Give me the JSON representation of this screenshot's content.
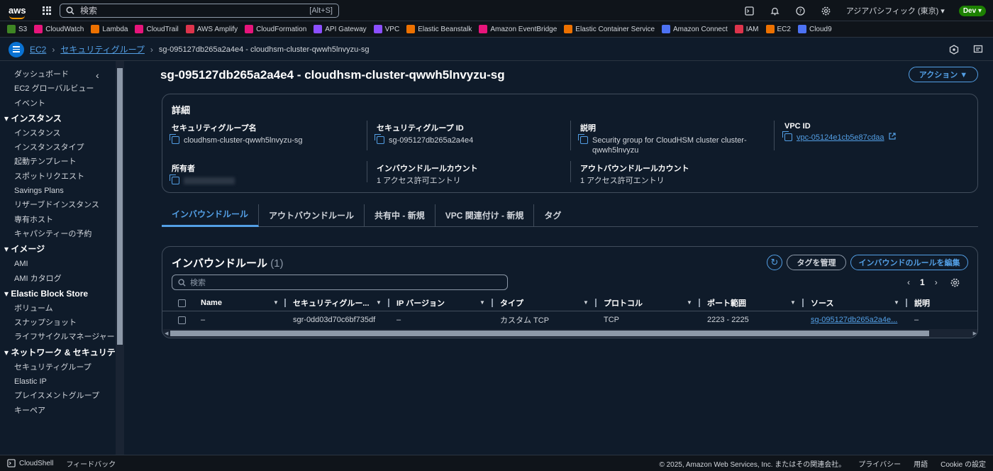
{
  "topbar": {
    "logo": "aws",
    "search_placeholder": "検索",
    "search_shortcut": "[Alt+S]",
    "region": "アジアパシフィック (東京)",
    "account_badge": "Dev"
  },
  "favorites": [
    {
      "label": "S3",
      "color": "#3f8624"
    },
    {
      "label": "CloudWatch",
      "color": "#e7157b"
    },
    {
      "label": "Lambda",
      "color": "#ed7100"
    },
    {
      "label": "CloudTrail",
      "color": "#e7157b"
    },
    {
      "label": "AWS Amplify",
      "color": "#dd344c"
    },
    {
      "label": "CloudFormation",
      "color": "#e7157b"
    },
    {
      "label": "API Gateway",
      "color": "#8c4fff"
    },
    {
      "label": "VPC",
      "color": "#8c4fff"
    },
    {
      "label": "Elastic Beanstalk",
      "color": "#ed7100"
    },
    {
      "label": "Amazon EventBridge",
      "color": "#e7157b"
    },
    {
      "label": "Elastic Container Service",
      "color": "#ed7100"
    },
    {
      "label": "Amazon Connect",
      "color": "#4d72f3"
    },
    {
      "label": "IAM",
      "color": "#dd344c"
    },
    {
      "label": "EC2",
      "color": "#ed7100"
    },
    {
      "label": "Cloud9",
      "color": "#4d72f3"
    }
  ],
  "breadcrumb": {
    "items": [
      "EC2",
      "セキュリティグループ"
    ],
    "current": "sg-095127db265a2a4e4 - cloudhsm-cluster-qwwh5lnvyzu-sg"
  },
  "sidebar": {
    "top": [
      "ダッシュボード",
      "EC2 グローバルビュー",
      "イベント"
    ],
    "sections": [
      {
        "title": "インスタンス",
        "items": [
          "インスタンス",
          "インスタンスタイプ",
          "起動テンプレート",
          "スポットリクエスト",
          "Savings Plans",
          "リザーブドインスタンス",
          "専有ホスト",
          "キャパシティーの予約"
        ]
      },
      {
        "title": "イメージ",
        "items": [
          "AMI",
          "AMI カタログ"
        ]
      },
      {
        "title": "Elastic Block Store",
        "items": [
          "ボリューム",
          "スナップショット",
          "ライフサイクルマネージャー"
        ]
      },
      {
        "title": "ネットワーク & セキュリティ",
        "items": [
          "セキュリティグループ",
          "Elastic IP",
          "プレイスメントグループ",
          "キーペア"
        ]
      }
    ]
  },
  "page": {
    "title": "sg-095127db265a2a4e4 - cloudhsm-cluster-qwwh5lnvyzu-sg",
    "actions_label": "アクション ▼"
  },
  "details": {
    "title": "詳細",
    "sg_name_label": "セキュリティグループ名",
    "sg_name": "cloudhsm-cluster-qwwh5lnvyzu-sg",
    "sg_id_label": "セキュリティグループ ID",
    "sg_id": "sg-095127db265a2a4e4",
    "desc_label": "説明",
    "desc": "Security group for CloudHSM cluster cluster-qwwh5lnvyzu",
    "vpc_label": "VPC ID",
    "vpc": "vpc-05124e1cb5e87cdaa",
    "owner_label": "所有者",
    "inbound_count_label": "インバウンドルールカウント",
    "inbound_count": "1 アクセス許可エントリ",
    "outbound_count_label": "アウトバウンドルールカウント",
    "outbound_count": "1 アクセス許可エントリ"
  },
  "tabs": [
    "インバウンドルール",
    "アウトバウンドルール",
    "共有中 - 新規",
    "VPC 関連付け - 新規",
    "タグ"
  ],
  "rules": {
    "title": "インバウンドルール",
    "count": "(1)",
    "manage_tags": "タグを管理",
    "edit_rules": "インバウンドのルールを編集",
    "search_placeholder": "検索",
    "page": "1",
    "columns": [
      "Name",
      "セキュリティグルー...",
      "IP バージョン",
      "タイプ",
      "プロトコル",
      "ポート範囲",
      "ソース",
      "説明"
    ],
    "rows": [
      {
        "name": "–",
        "sgr": "sgr-0dd03d70c6bf735df",
        "ip": "–",
        "type": "カスタム TCP",
        "protocol": "TCP",
        "port": "2223 - 2225",
        "source": "sg-095127db265a2a4e...",
        "desc": "–"
      }
    ]
  },
  "footer": {
    "cloudshell": "CloudShell",
    "feedback": "フィードバック",
    "copyright": "© 2025, Amazon Web Services, Inc. またはその関連会社。",
    "privacy": "プライバシー",
    "terms": "用語",
    "cookie": "Cookie の設定"
  }
}
